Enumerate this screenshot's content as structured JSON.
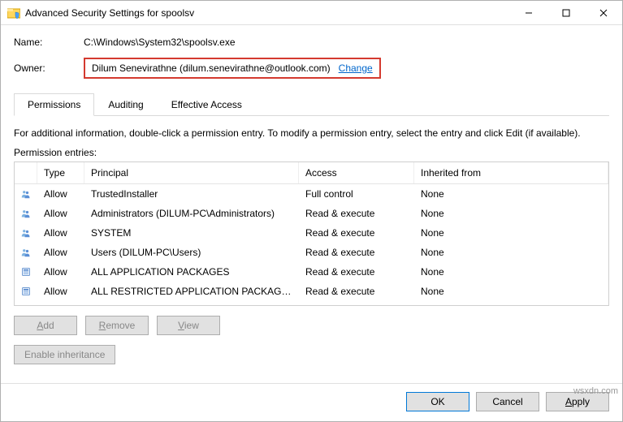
{
  "title": "Advanced Security Settings for spoolsv",
  "labels": {
    "name": "Name:",
    "owner": "Owner:",
    "change": "Change",
    "info": "For additional information, double-click a permission entry. To modify a permission entry, select the entry and click Edit (if available).",
    "entries": "Permission entries:"
  },
  "fields": {
    "name": "C:\\Windows\\System32\\spoolsv.exe",
    "owner": "Dilum Senevirathne (dilum.senevirathne@outlook.com)"
  },
  "tabs": {
    "permissions": "Permissions",
    "auditing": "Auditing",
    "effective": "Effective Access"
  },
  "columns": {
    "type": "Type",
    "principal": "Principal",
    "access": "Access",
    "inherited": "Inherited from"
  },
  "entries": [
    {
      "icon": "people",
      "type": "Allow",
      "principal": "TrustedInstaller",
      "access": "Full control",
      "inherited": "None"
    },
    {
      "icon": "people",
      "type": "Allow",
      "principal": "Administrators (DILUM-PC\\Administrators)",
      "access": "Read & execute",
      "inherited": "None"
    },
    {
      "icon": "people",
      "type": "Allow",
      "principal": "SYSTEM",
      "access": "Read & execute",
      "inherited": "None"
    },
    {
      "icon": "people",
      "type": "Allow",
      "principal": "Users (DILUM-PC\\Users)",
      "access": "Read & execute",
      "inherited": "None"
    },
    {
      "icon": "pkg",
      "type": "Allow",
      "principal": "ALL APPLICATION PACKAGES",
      "access": "Read & execute",
      "inherited": "None"
    },
    {
      "icon": "pkg",
      "type": "Allow",
      "principal": "ALL RESTRICTED APPLICATION PACKAGES",
      "access": "Read & execute",
      "inherited": "None"
    }
  ],
  "buttons": {
    "add": "Add",
    "remove": "Remove",
    "view": "View",
    "enable_inh": "Enable inheritance",
    "ok": "OK",
    "cancel": "Cancel",
    "apply": "Apply"
  },
  "watermark": "wsxdn.com"
}
